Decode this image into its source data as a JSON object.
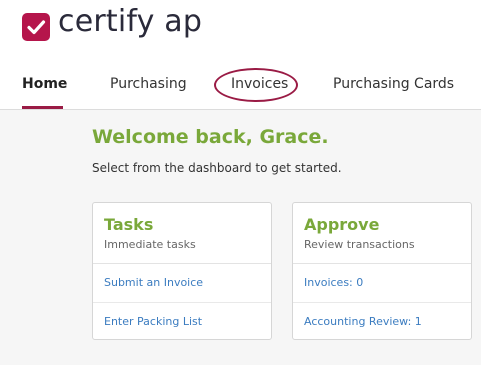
{
  "brand": {
    "name": "certify ap",
    "accent": "#b5154b"
  },
  "nav": {
    "tabs": [
      {
        "label": "Home",
        "active": true
      },
      {
        "label": "Purchasing",
        "active": false
      },
      {
        "label": "Invoices",
        "active": false
      },
      {
        "label": "Purchasing Cards",
        "active": false
      }
    ]
  },
  "main": {
    "welcome": "Welcome back, Grace.",
    "subtitle": "Select from the dashboard to get started."
  },
  "cards": [
    {
      "title": "Tasks",
      "subtitle": "Immediate tasks",
      "links": [
        "Submit an Invoice",
        "Enter Packing List"
      ]
    },
    {
      "title": "Approve",
      "subtitle": "Review transactions",
      "links": [
        "Invoices: 0",
        "Accounting Review: 1"
      ]
    }
  ],
  "colors": {
    "heading_green": "#7aa83a",
    "link_blue": "#3b7cc0",
    "highlight": "#9a1b45"
  }
}
